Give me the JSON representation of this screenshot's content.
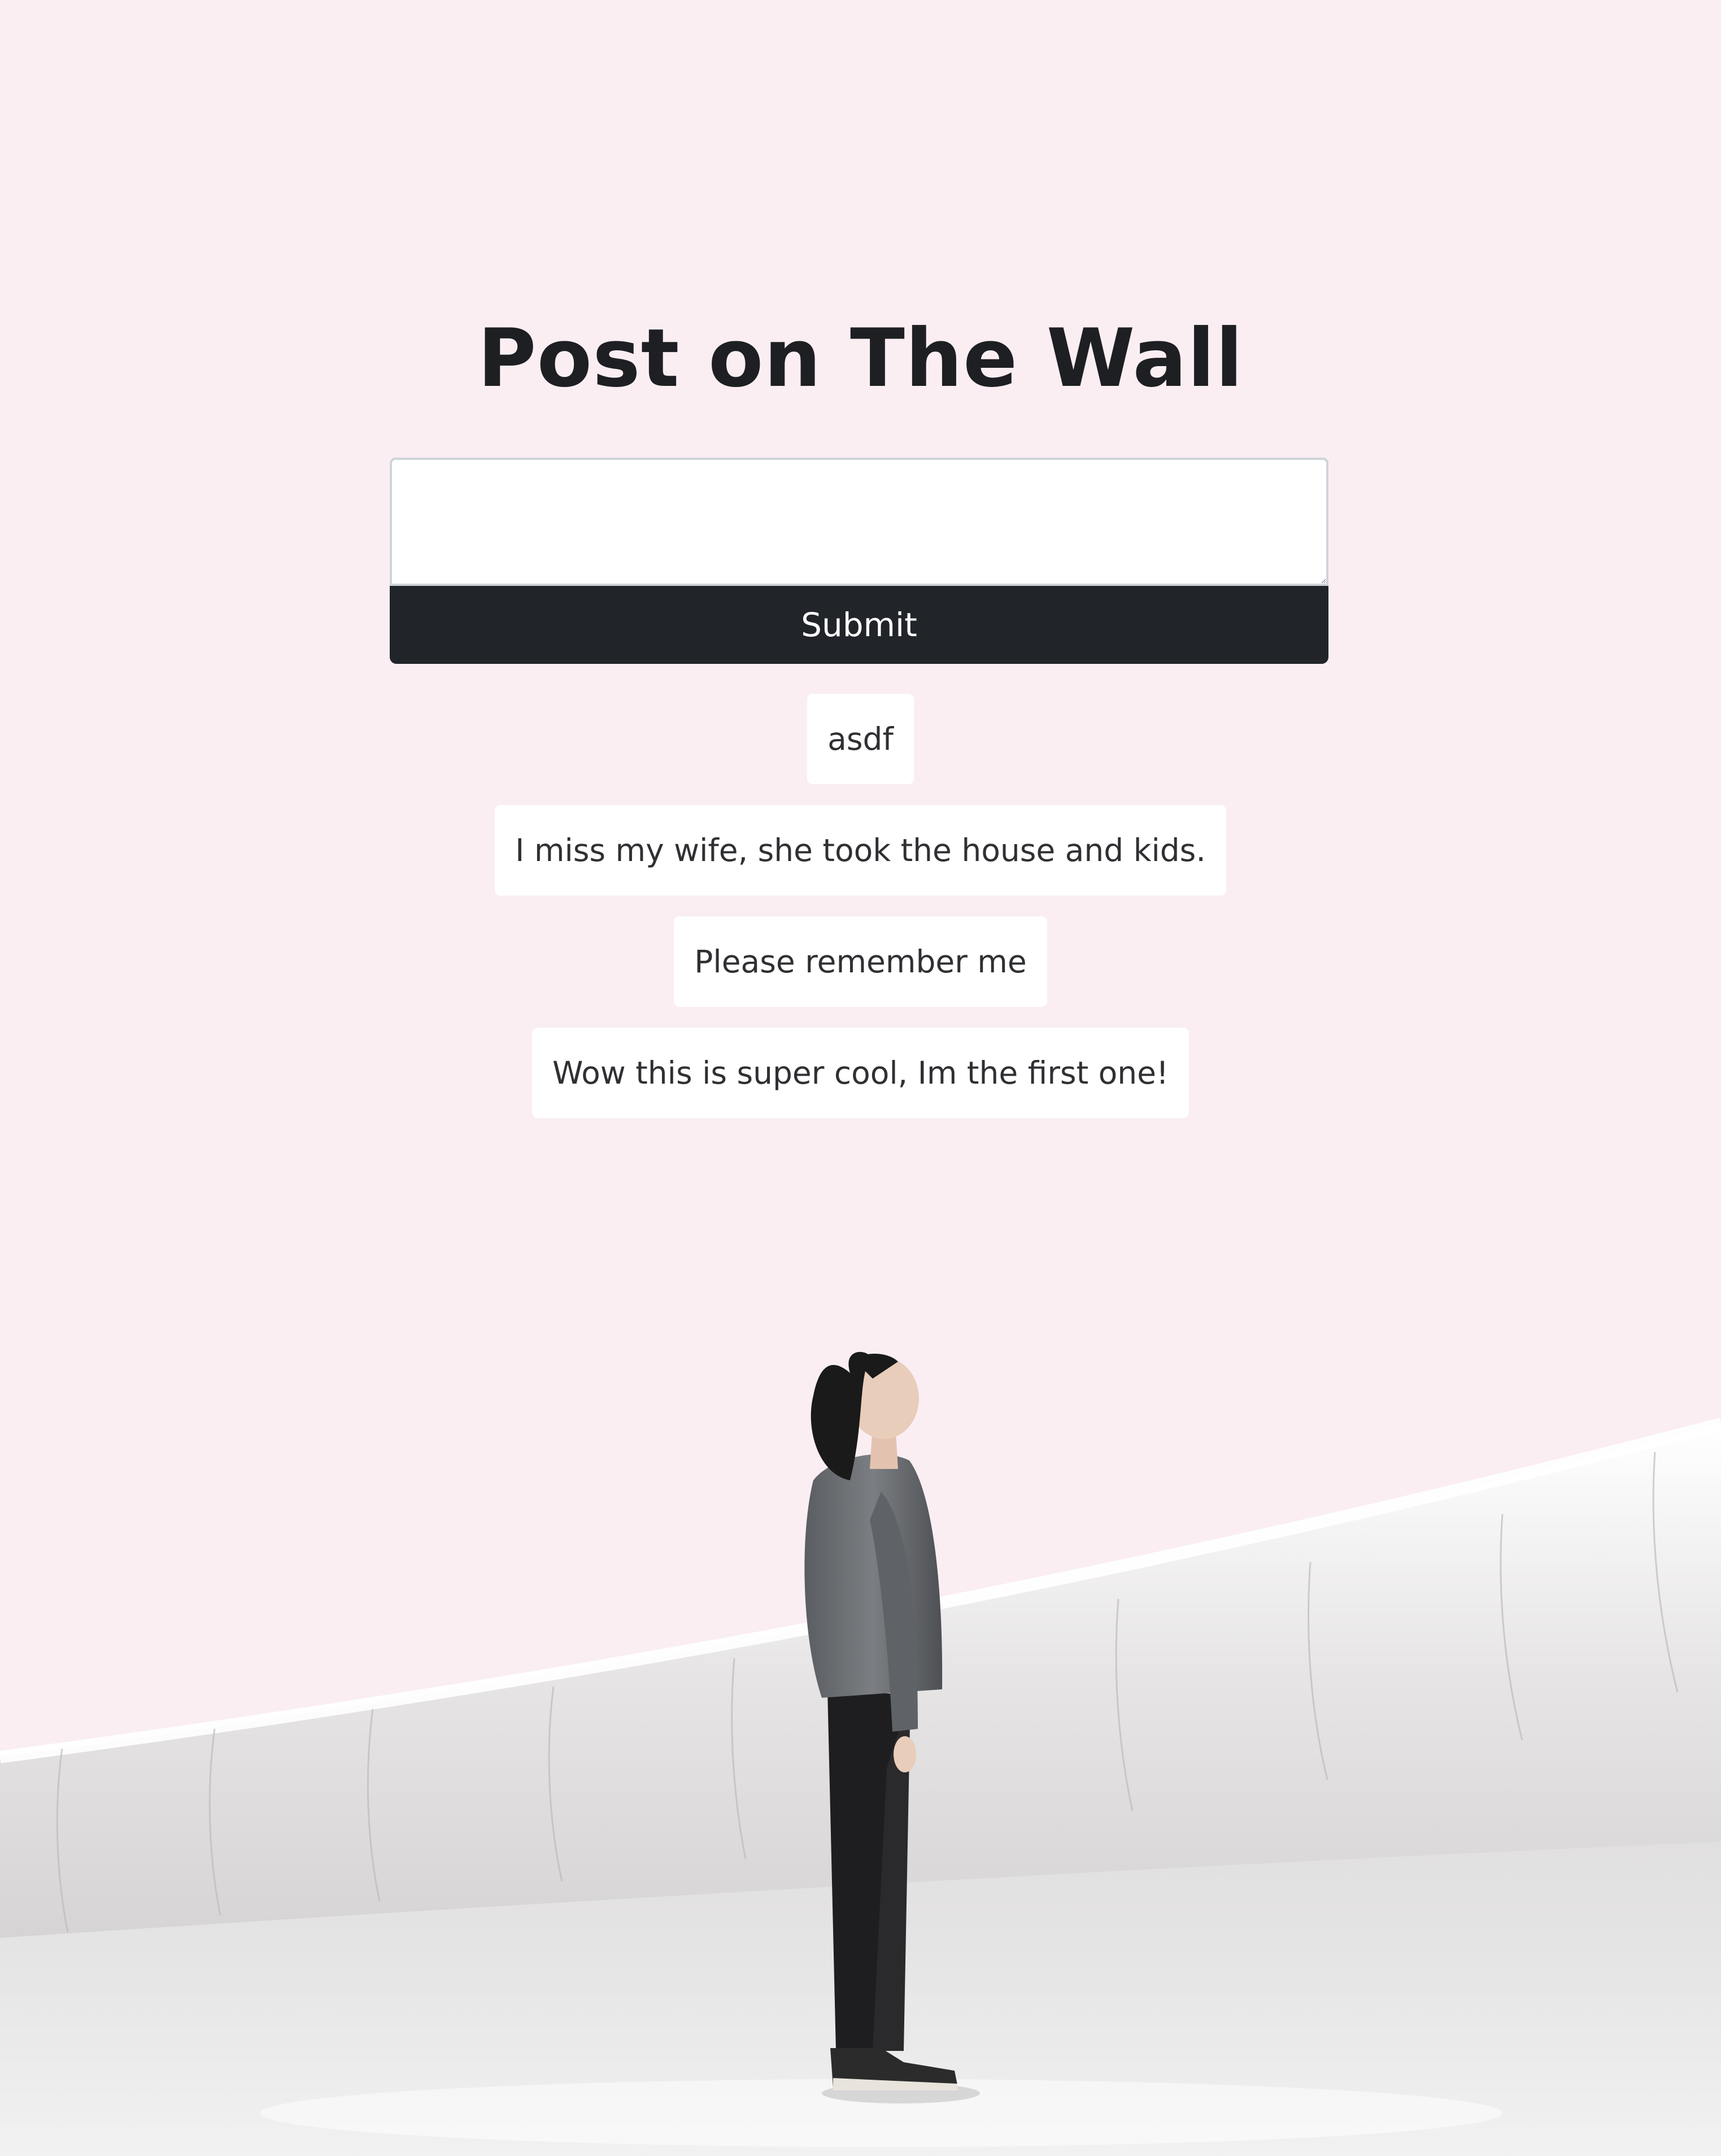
{
  "colors": {
    "page_background": "#faeef3",
    "button_background": "#212529",
    "button_text": "#ffffff",
    "post_background": "#ffffff",
    "title_text": "#1e1f22"
  },
  "header": {
    "title": "Post on The Wall"
  },
  "form": {
    "textarea_value": "",
    "textarea_placeholder": "",
    "submit_label": "Submit"
  },
  "posts": [
    {
      "text": "asdf"
    },
    {
      "text": "I miss my wife, she took the house and kids."
    },
    {
      "text": "Please remember me"
    },
    {
      "text": "Wow this is super cool, Im the first one!"
    }
  ],
  "background_image": {
    "subject": "person-looking-up-in-white-curved-hall"
  }
}
